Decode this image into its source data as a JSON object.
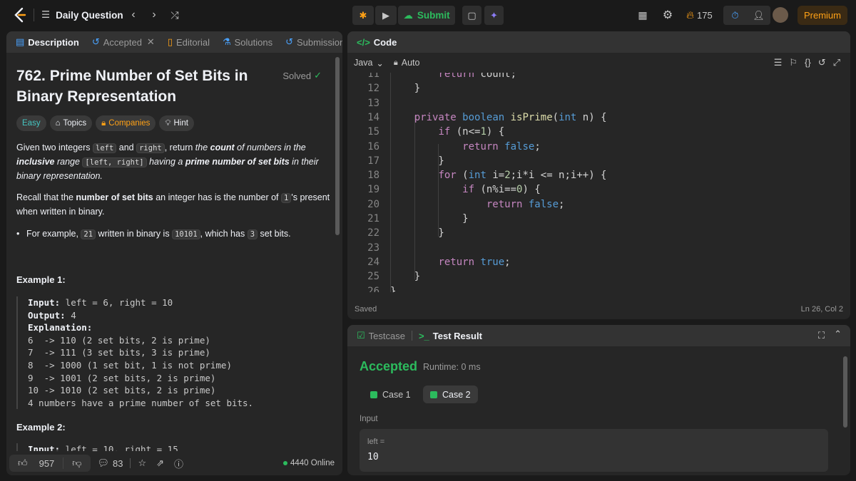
{
  "topbar": {
    "title": "Daily Question",
    "submit_label": "Submit",
    "streak": "175",
    "premium_label": "Premium"
  },
  "left_tabs": [
    {
      "label": "Description"
    },
    {
      "label": "Accepted"
    },
    {
      "label": "Editorial"
    },
    {
      "label": "Solutions"
    },
    {
      "label": "Submissions"
    }
  ],
  "problem": {
    "title_line1": "762. Prime Number of Set Bits in",
    "title_line2": "Binary Representation",
    "status": "Solved",
    "chips": [
      "Easy",
      "Topics",
      "Companies",
      "Hint"
    ],
    "p1": {
      "a": "Given two integers ",
      "c1": "left",
      "b": " and ",
      "c2": "right",
      "c": ", return ",
      "d": "the ",
      "e": "count",
      "f": " of numbers in the ",
      "g": "inclusive",
      "h": " range ",
      "c3": "[left, right]",
      "i": " having a ",
      "j": "prime number of set bits",
      "k": " in their binary representation."
    },
    "p2": {
      "a": "Recall that the ",
      "b": "number of set bits",
      "c": " an integer has is the number of ",
      "c1": "1",
      "d": "'s present when written in binary."
    },
    "bullet": {
      "a": "For example, ",
      "c1": "21",
      "b": " written in binary is ",
      "c2": "10101",
      "c": ", which has ",
      "c3": "3",
      "d": " set bits."
    },
    "example1_title": "Example 1:",
    "example1": {
      "input_label": "Input:",
      "input": " left = 6, right = 10",
      "output_label": "Output:",
      "output": " 4",
      "expl_label": "Explanation:",
      "lines": [
        "6  -> 110 (2 set bits, 2 is prime)",
        "7  -> 111 (3 set bits, 3 is prime)",
        "8  -> 1000 (1 set bit, 1 is not prime)",
        "9  -> 1001 (2 set bits, 2 is prime)",
        "10 -> 1010 (2 set bits, 2 is prime)",
        "4 numbers have a prime number of set bits."
      ]
    },
    "example2_title": "Example 2:",
    "example2_input_label": "Input:",
    "example2_input": " left = 10, right = 15"
  },
  "footer": {
    "likes": "957",
    "comments": "83",
    "online": "4440 Online"
  },
  "code_panel": {
    "title": "Code",
    "language": "Java",
    "mode": "Auto",
    "saved": "Saved",
    "cursor": "Ln 26, Col 2",
    "lines": [
      {
        "n": "11",
        "t": "        return count;"
      },
      {
        "n": "12",
        "t": "    }"
      },
      {
        "n": "13",
        "t": ""
      },
      {
        "n": "14",
        "t": "    private boolean isPrime(int n) {"
      },
      {
        "n": "15",
        "t": "        if (n<=1) {"
      },
      {
        "n": "16",
        "t": "            return false;"
      },
      {
        "n": "17",
        "t": "        }"
      },
      {
        "n": "18",
        "t": "        for (int i=2;i*i <= n;i++) {"
      },
      {
        "n": "19",
        "t": "            if (n%i==0) {"
      },
      {
        "n": "20",
        "t": "                return false;"
      },
      {
        "n": "21",
        "t": "            }"
      },
      {
        "n": "22",
        "t": "        }"
      },
      {
        "n": "23",
        "t": ""
      },
      {
        "n": "24",
        "t": "        return true;"
      },
      {
        "n": "25",
        "t": "    }"
      },
      {
        "n": "26",
        "t": "}"
      }
    ]
  },
  "test_panel": {
    "tab_testcase": "Testcase",
    "tab_result": "Test Result",
    "verdict": "Accepted",
    "runtime": "Runtime: 0 ms",
    "case1": "Case 1",
    "case2": "Case 2",
    "input_label": "Input",
    "var_name": "left =",
    "var_value": "10"
  },
  "colors": {
    "accent_green": "#2cbb5d",
    "accent_orange": "#ffa116",
    "easy": "#46c6c2",
    "keyword": "#c586c0",
    "type": "#569cd6"
  }
}
